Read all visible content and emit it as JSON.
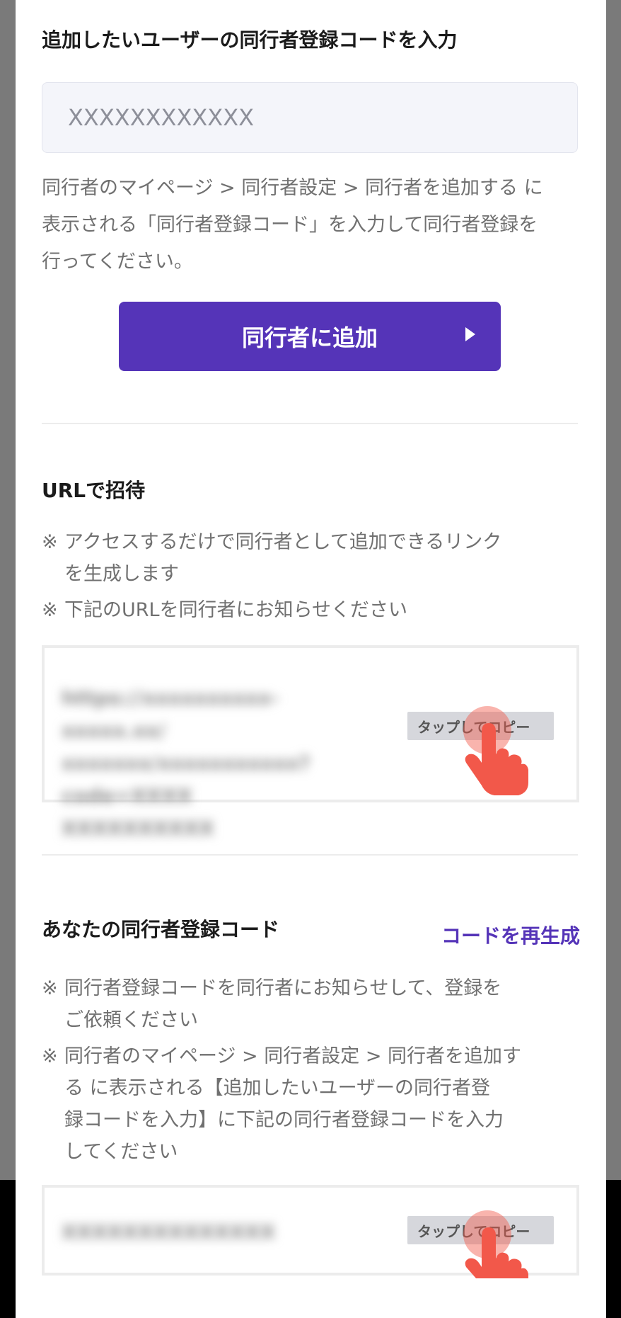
{
  "add_section": {
    "title": "追加したいユーザーの同行者登録コードを入力",
    "input_placeholder": "XXXXXXXXXXXX",
    "help_lines": [
      "同行者のマイページ > 同行者設定 > 同行者を追加する に",
      "表示される「同行者登録コード」を入力して同行者登録を",
      "行ってください。"
    ],
    "button_label": "同行者に追加"
  },
  "url_section": {
    "title": "URLで招待",
    "notes": [
      [
        "アクセスするだけで同行者として追加できるリンク",
        "を生成します"
      ],
      [
        "下記のURLを同行者にお知らせください"
      ]
    ],
    "note_mark": "※",
    "url_lines": [
      "https://xxxxxxxxxx-xxxxx.xx/",
      "xxxxxxx/xxxxxxxxxxx?code=XXXX",
      "XXXXXXXXXX"
    ],
    "copy_label": "タップしてコピー"
  },
  "code_section": {
    "title": "あなたの同行者登録コード",
    "regenerate_label": "コードを再生成",
    "notes": [
      [
        "同行者登録コードを同行者にお知らせして、登録を",
        "ご依頼ください"
      ],
      [
        "同行者のマイページ > 同行者設定 > 同行者を追加す",
        "る に表示される【追加したいユーザーの同行者登",
        "録コードを入力】に下記の同行者登録コードを入力",
        "してください"
      ]
    ],
    "code_value": "XXXXXXXXXXXXXX",
    "copy_label": "タップしてコピー"
  },
  "colors": {
    "accent": "#5534b8",
    "hand": "#f2584a"
  }
}
